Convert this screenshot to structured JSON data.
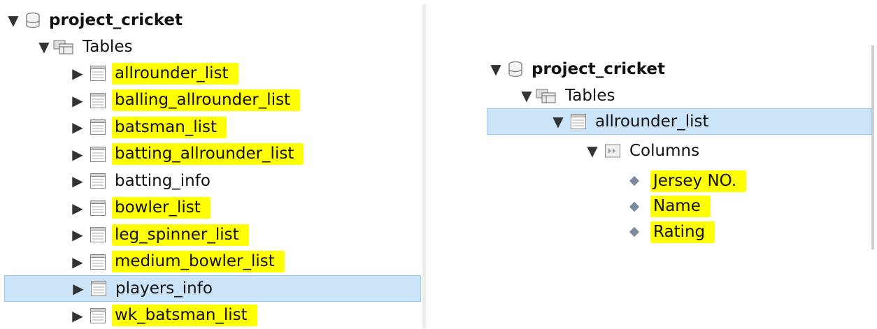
{
  "left": {
    "db_name": "project_cricket",
    "tables_label": "Tables",
    "tables": [
      {
        "name": "allrounder_list",
        "highlighted": true
      },
      {
        "name": "balling_allrounder_list",
        "highlighted": true
      },
      {
        "name": "batsman_list",
        "highlighted": true
      },
      {
        "name": "batting_allrounder_list",
        "highlighted": true
      },
      {
        "name": "batting_info",
        "highlighted": false
      },
      {
        "name": "bowler_list",
        "highlighted": true
      },
      {
        "name": "leg_spinner_list",
        "highlighted": true
      },
      {
        "name": "medium_bowler_list",
        "highlighted": true
      },
      {
        "name": "players_info",
        "highlighted": false,
        "selected": true
      },
      {
        "name": "wk_batsman_list",
        "highlighted": true
      }
    ]
  },
  "right": {
    "db_name": "project_cricket",
    "tables_label": "Tables",
    "selected_table": "allrounder_list",
    "columns_label": "Columns",
    "columns": [
      "Jersey NO.",
      "Name",
      "Rating"
    ]
  },
  "colors": {
    "highlight": "#ffff00",
    "selection": "#cce4f7",
    "selection_border": "#99c9ef"
  },
  "icons": {
    "database": "database-icon",
    "folder": "tables-folder-icon",
    "table": "table-icon",
    "columns": "columns-folder-icon",
    "column": "column-diamond-icon",
    "expand": "triangle-down-icon",
    "collapse": "triangle-right-icon"
  }
}
